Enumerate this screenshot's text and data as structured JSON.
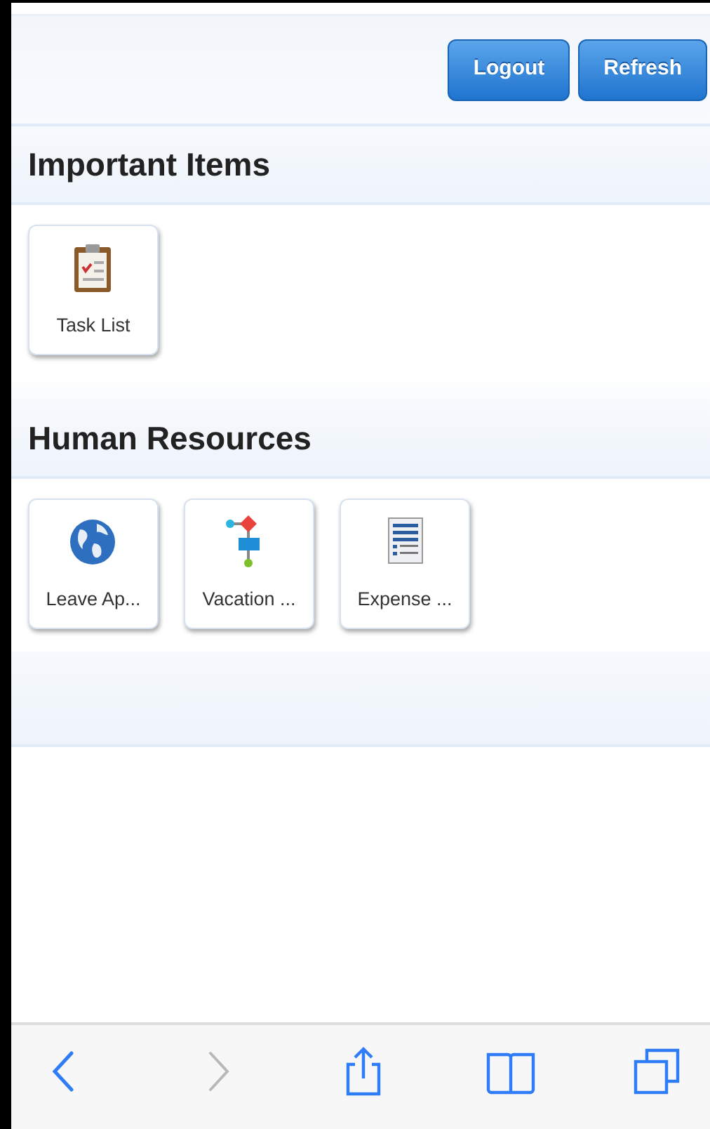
{
  "header": {
    "buttons": [
      "Logout",
      "Refresh"
    ]
  },
  "sections": [
    {
      "title": "Important Items",
      "tiles": [
        {
          "label": "Task List",
          "kind": "clipboard"
        }
      ]
    },
    {
      "title": "Human Resources",
      "tiles": [
        {
          "label": "Leave Ap...",
          "kind": "globe"
        },
        {
          "label": "Vacation ...",
          "kind": "flowchart"
        },
        {
          "label": "Expense ...",
          "kind": "document"
        }
      ]
    }
  ],
  "toolbar": [
    {
      "kind": "back",
      "disabled": false
    },
    {
      "kind": "forward",
      "disabled": true
    },
    {
      "kind": "share",
      "disabled": false
    },
    {
      "kind": "bookmarks",
      "disabled": false
    },
    {
      "kind": "tabs",
      "disabled": false
    }
  ]
}
